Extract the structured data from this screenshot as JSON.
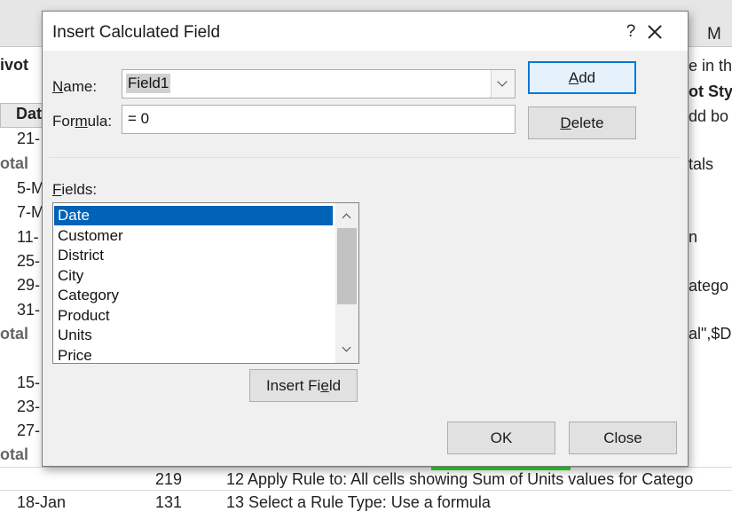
{
  "sheet": {
    "column_header_m": "M",
    "left_cells": [
      {
        "text": "ivot",
        "style": "bold"
      },
      {
        "text": "Dat",
        "style": "bold"
      },
      {
        "text": "21-",
        "style": ""
      },
      {
        "text": "otal",
        "style": "gray"
      },
      {
        "text": "5-M",
        "style": ""
      },
      {
        "text": "7-M",
        "style": ""
      },
      {
        "text": "11-",
        "style": ""
      },
      {
        "text": "25-",
        "style": ""
      },
      {
        "text": "29-",
        "style": ""
      },
      {
        "text": "31-",
        "style": ""
      },
      {
        "text": "otal",
        "style": "gray"
      },
      {
        "text": "15-",
        "style": ""
      },
      {
        "text": "23-",
        "style": ""
      },
      {
        "text": "27-",
        "style": ""
      },
      {
        "text": "otal",
        "style": "gray"
      }
    ],
    "right_cells": [
      {
        "text": "e in th",
        "style": ""
      },
      {
        "text": "ot Sty",
        "style": "bold"
      },
      {
        "text": "dd bo",
        "style": ""
      },
      {
        "text": "tals",
        "style": ""
      },
      {
        "text": "n",
        "style": ""
      },
      {
        "text": "atego",
        "style": ""
      },
      {
        "text": "al\",$D7",
        "style": ""
      }
    ],
    "bottom_rows": [
      {
        "date": "",
        "value": "219",
        "step": "12 Apply Rule to: All cells showing Sum of Units values for Catego"
      },
      {
        "date": "18-Jan",
        "value": "131",
        "step": "13 Select a Rule Type: Use a formula"
      }
    ]
  },
  "dialog": {
    "title": "Insert Calculated Field",
    "help_label": "?",
    "name_label_pre": "",
    "name_label_u": "N",
    "name_label_post": "ame:",
    "name_value": "Field1",
    "formula_label_pre": "For",
    "formula_label_u": "m",
    "formula_label_post": "ula:",
    "formula_value": "= 0",
    "add_pre": "",
    "add_u": "A",
    "add_post": "dd",
    "delete_pre": "",
    "delete_u": "D",
    "delete_post": "elete",
    "fields_label_pre": "",
    "fields_label_u": "F",
    "fields_label_post": "ields:",
    "fields": [
      "Date",
      "Customer",
      "District",
      "City",
      "Category",
      "Product",
      "Units",
      "Price"
    ],
    "selected_field": "Date",
    "insert_field_pre": "Insert Fi",
    "insert_field_u": "e",
    "insert_field_post": "ld",
    "ok_label": "OK",
    "close_label": "Close"
  },
  "colors": {
    "selection": "#0063b8",
    "highlight": "#27e82a",
    "default_button_border": "#0078d7"
  }
}
